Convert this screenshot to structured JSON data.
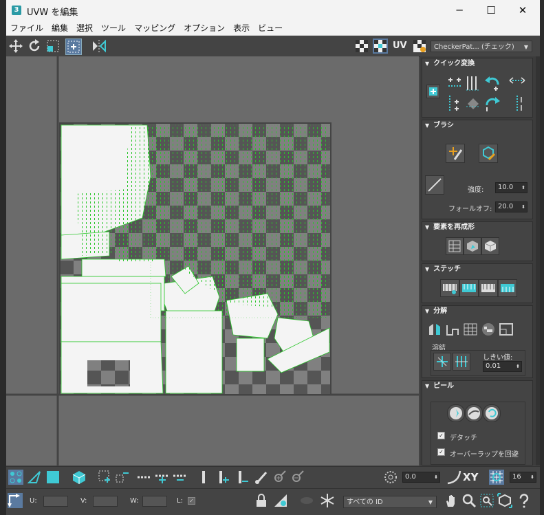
{
  "window": {
    "title": "UVW を編集",
    "min": "─",
    "max": "☐",
    "close": "✕",
    "logo": "3"
  },
  "menu": [
    "ファイル",
    "編集",
    "選択",
    "ツール",
    "マッピング",
    "オプション",
    "表示",
    "ビュー"
  ],
  "toolbar": {
    "uv_label": "UV",
    "texture_select": "CheckerPat... (チェック)"
  },
  "quick_transform": {
    "title": "クイック変換"
  },
  "brush": {
    "title": "ブラシ",
    "strength_label": "強度:",
    "strength_value": "10.0",
    "falloff_label": "フォールオフ:",
    "falloff_value": "20.0"
  },
  "reshape": {
    "title": "要素を再成形"
  },
  "stitch": {
    "title": "ステッチ"
  },
  "explode": {
    "title": "分解",
    "weld_label": "溶結",
    "threshold_label": "しきい値:",
    "threshold_value": "0.01"
  },
  "peel": {
    "title": "ピール",
    "detach_label": "デタッチ",
    "detach_checked": true,
    "avoid_overlap_label": "オーバーラップを回避",
    "avoid_overlap_checked": true
  },
  "bottom": {
    "rotate_value": "0.0",
    "xy_label": "XY",
    "grid_value": "16",
    "u_label": "U:",
    "v_label": "V:",
    "w_label": "W:",
    "l_label": "L:",
    "id_select": "すべての ID"
  },
  "colors": {
    "accent": "#3fc9d4",
    "uv_edges": "#29c629",
    "checker_dark": "#555555",
    "checker_light": "#808080"
  }
}
